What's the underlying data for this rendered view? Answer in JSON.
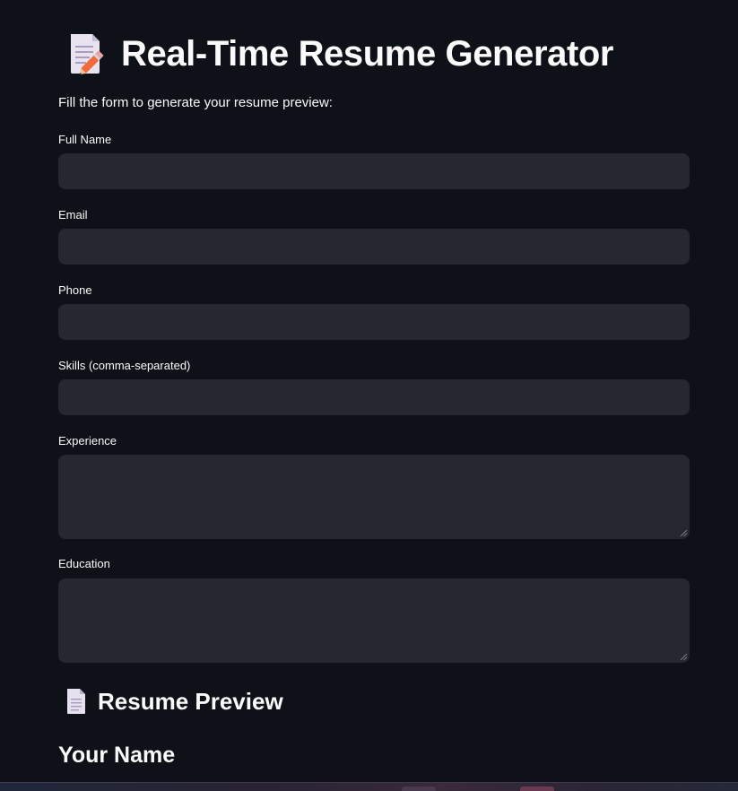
{
  "header": {
    "title": "Real-Time Resume Generator",
    "title_icon": "memo-pencil-icon",
    "subtitle": "Fill the form to generate your resume preview:"
  },
  "form": {
    "full_name": {
      "label": "Full Name",
      "value": ""
    },
    "email": {
      "label": "Email",
      "value": ""
    },
    "phone": {
      "label": "Phone",
      "value": ""
    },
    "skills": {
      "label": "Skills (comma-separated)",
      "value": ""
    },
    "experience": {
      "label": "Experience",
      "value": ""
    },
    "education": {
      "label": "Education",
      "value": ""
    }
  },
  "preview": {
    "heading": "Resume Preview",
    "heading_icon": "page-icon",
    "name_placeholder": "Your Name"
  },
  "colors": {
    "background": "#0e1117",
    "input_background": "#262730",
    "text": "#fafafa"
  }
}
